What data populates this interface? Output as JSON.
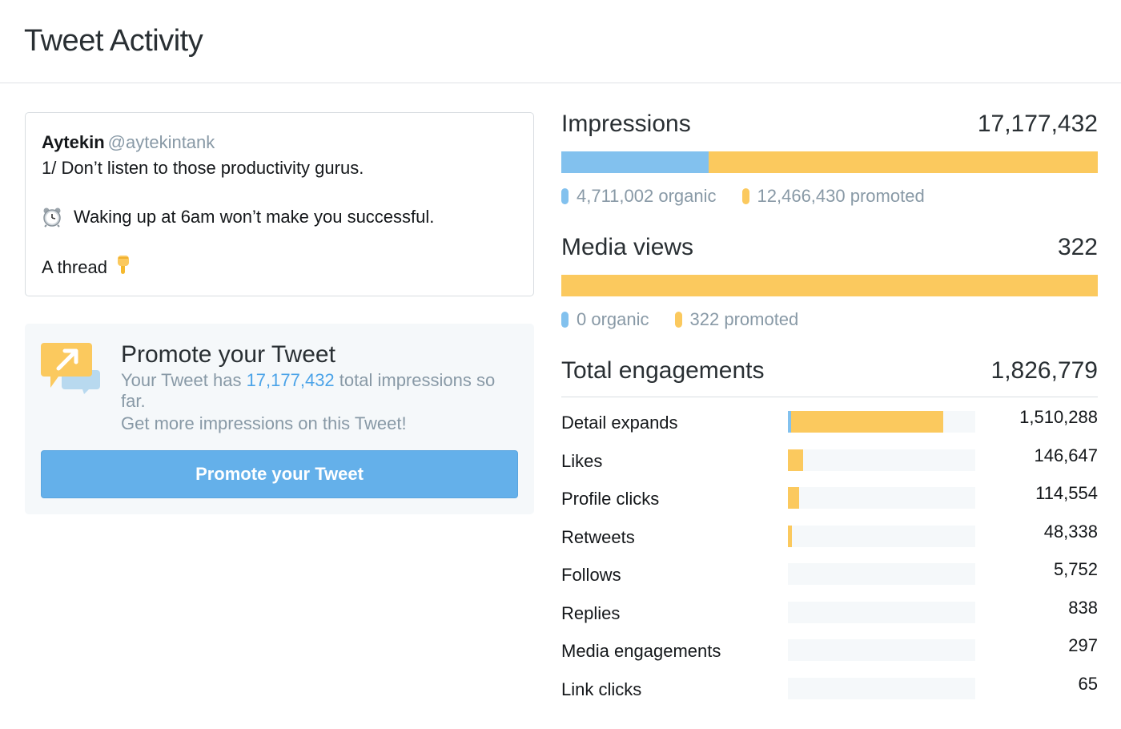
{
  "page": {
    "title": "Tweet Activity"
  },
  "tweet": {
    "author_name": "Aytekin",
    "author_handle": "@aytekintank",
    "line1": "1/ Don’t listen to those productivity gurus.",
    "line2": "Waking up at 6am won’t make you successful.",
    "line3": "A thread",
    "line2_emoji": "alarm-clock-icon",
    "line3_emoji": "pointing-down-icon"
  },
  "promote": {
    "title": "Promote your Tweet",
    "text_before": "Your Tweet has ",
    "impressions": "17,177,432",
    "text_after": " total impressions so far.",
    "text2": "Get more impressions on this Tweet!",
    "button_label": "Promote your Tweet",
    "icon": "promote-chat-arrow-icon"
  },
  "colors": {
    "organic": "#82c1ee",
    "promoted": "#fbc95e",
    "button": "#64b0ea",
    "link": "#4ba3e8"
  },
  "impressions": {
    "label": "Impressions",
    "value": "17,177,432",
    "organic_label": "4,711,002 organic",
    "promoted_label": "12,466,430 promoted",
    "organic": 4711002,
    "promoted": 12466430
  },
  "media_views": {
    "label": "Media views",
    "value": "322",
    "organic_label": "0 organic",
    "promoted_label": "322 promoted",
    "organic": 0,
    "promoted": 322
  },
  "engagements": {
    "label": "Total engagements",
    "value": "1,826,779",
    "rows": [
      {
        "label": "Detail expands",
        "value": "1,510,288",
        "promoted_fraction": 0.83,
        "organic_fraction": 0.015
      },
      {
        "label": "Likes",
        "value": "146,647",
        "promoted_fraction": 0.08,
        "organic_fraction": 0
      },
      {
        "label": "Profile clicks",
        "value": "114,554",
        "promoted_fraction": 0.06,
        "organic_fraction": 0
      },
      {
        "label": "Retweets",
        "value": "48,338",
        "promoted_fraction": 0.02,
        "organic_fraction": 0
      },
      {
        "label": "Follows",
        "value": "5,752",
        "promoted_fraction": 0,
        "organic_fraction": 0
      },
      {
        "label": "Replies",
        "value": "838",
        "promoted_fraction": 0,
        "organic_fraction": 0
      },
      {
        "label": "Media engagements",
        "value": "297",
        "promoted_fraction": 0,
        "organic_fraction": 0
      },
      {
        "label": "Link clicks",
        "value": "65",
        "promoted_fraction": 0,
        "organic_fraction": 0
      }
    ]
  }
}
